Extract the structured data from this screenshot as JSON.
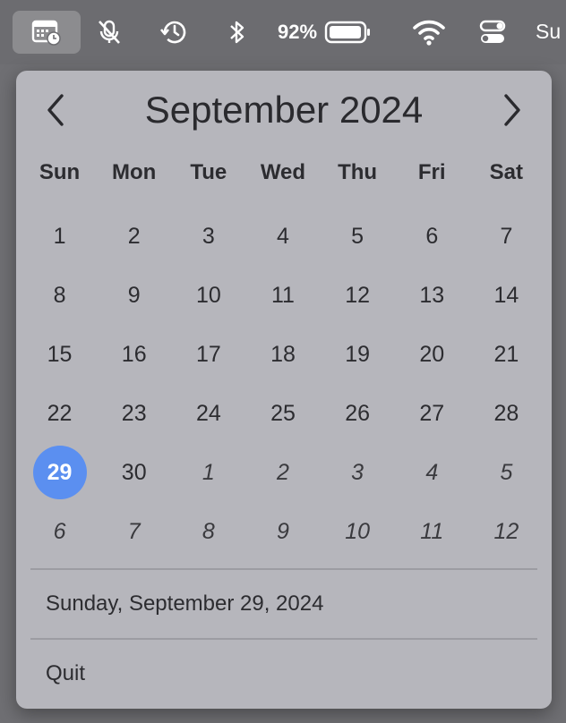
{
  "menubar": {
    "battery_percent": "92%",
    "battery_level": 0.92,
    "partial_text": "Su"
  },
  "calendar": {
    "title": "September 2024",
    "weekdays": [
      "Sun",
      "Mon",
      "Tue",
      "Wed",
      "Thu",
      "Fri",
      "Sat"
    ],
    "days": [
      {
        "label": "1",
        "other": false
      },
      {
        "label": "2",
        "other": false
      },
      {
        "label": "3",
        "other": false
      },
      {
        "label": "4",
        "other": false
      },
      {
        "label": "5",
        "other": false
      },
      {
        "label": "6",
        "other": false
      },
      {
        "label": "7",
        "other": false
      },
      {
        "label": "8",
        "other": false
      },
      {
        "label": "9",
        "other": false
      },
      {
        "label": "10",
        "other": false
      },
      {
        "label": "11",
        "other": false
      },
      {
        "label": "12",
        "other": false
      },
      {
        "label": "13",
        "other": false
      },
      {
        "label": "14",
        "other": false
      },
      {
        "label": "15",
        "other": false
      },
      {
        "label": "16",
        "other": false
      },
      {
        "label": "17",
        "other": false
      },
      {
        "label": "18",
        "other": false
      },
      {
        "label": "19",
        "other": false
      },
      {
        "label": "20",
        "other": false
      },
      {
        "label": "21",
        "other": false
      },
      {
        "label": "22",
        "other": false
      },
      {
        "label": "23",
        "other": false
      },
      {
        "label": "24",
        "other": false
      },
      {
        "label": "25",
        "other": false
      },
      {
        "label": "26",
        "other": false
      },
      {
        "label": "27",
        "other": false
      },
      {
        "label": "28",
        "other": false
      },
      {
        "label": "29",
        "other": false,
        "today": true
      },
      {
        "label": "30",
        "other": false
      },
      {
        "label": "1",
        "other": true
      },
      {
        "label": "2",
        "other": true
      },
      {
        "label": "3",
        "other": true
      },
      {
        "label": "4",
        "other": true
      },
      {
        "label": "5",
        "other": true
      },
      {
        "label": "6",
        "other": true
      },
      {
        "label": "7",
        "other": true
      },
      {
        "label": "8",
        "other": true
      },
      {
        "label": "9",
        "other": true
      },
      {
        "label": "10",
        "other": true
      },
      {
        "label": "11",
        "other": true
      },
      {
        "label": "12",
        "other": true
      }
    ],
    "selected_date_text": "Sunday, September 29, 2024",
    "quit_label": "Quit"
  },
  "colors": {
    "today_highlight": "#5b8ff0",
    "popover_bg": "#b6b6bc"
  },
  "icons": {
    "menubar": [
      "calendar-clock-icon",
      "mic-muted-icon",
      "time-machine-icon",
      "bluetooth-icon",
      "battery-icon",
      "wifi-icon",
      "control-center-icon"
    ],
    "nav": [
      "chevron-left-icon",
      "chevron-right-icon"
    ]
  }
}
